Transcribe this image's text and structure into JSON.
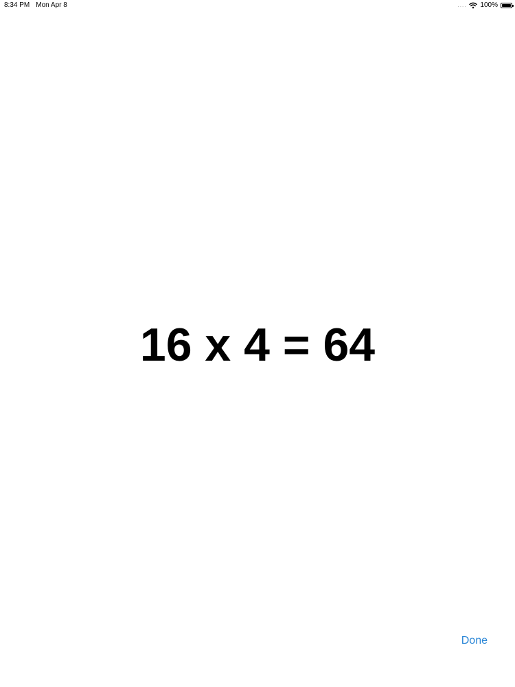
{
  "status_bar": {
    "time": "8:34 PM",
    "date": "Mon Apr 8",
    "signal_dots": "....",
    "battery_text": "100%",
    "battery_level": 1.0,
    "wifi_icon": "wifi-icon",
    "battery_icon": "battery-icon"
  },
  "main": {
    "equation": "16 x 4 = 64"
  },
  "actions": {
    "done_label": "Done",
    "accent_color": "#2a86d6"
  }
}
